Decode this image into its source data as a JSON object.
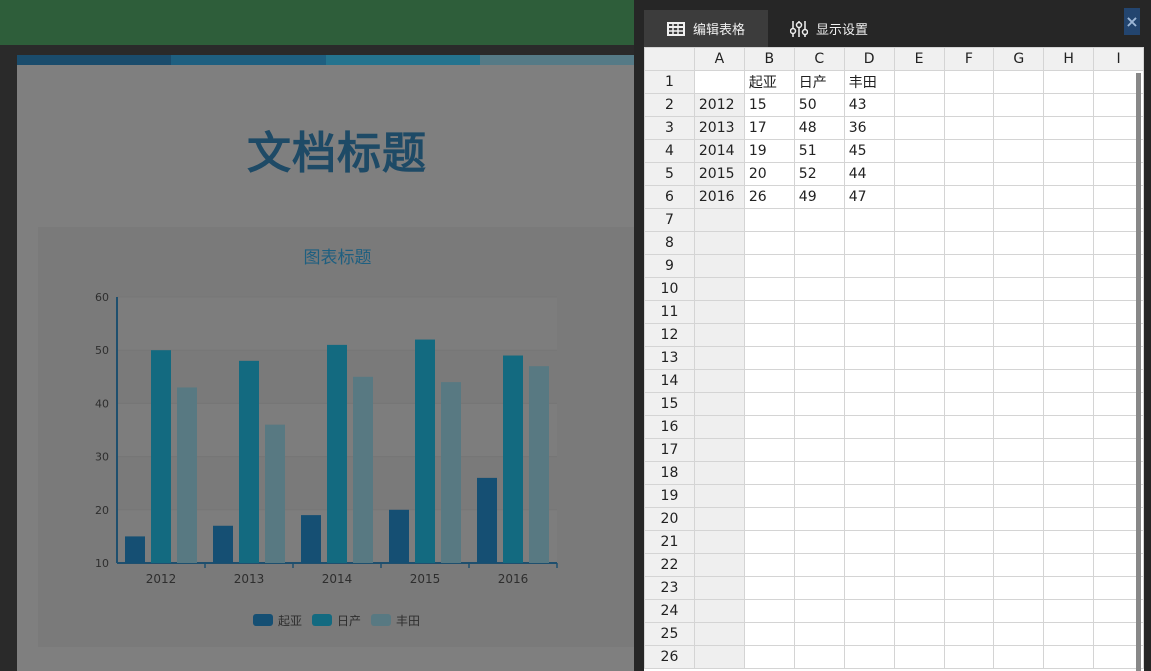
{
  "document": {
    "title": "文档标题",
    "title_color": "#1e4a66",
    "accent_colors": [
      "#1a4c6c",
      "#1e5f80",
      "#24738e",
      "#557a86"
    ]
  },
  "chart": {
    "title_color": "#1e5f80",
    "colors": [
      "#154f73",
      "#136a80",
      "#587982"
    ]
  },
  "chart_data": {
    "type": "bar",
    "title": "图表标题",
    "categories": [
      "2012",
      "2013",
      "2014",
      "2015",
      "2016"
    ],
    "series": [
      {
        "name": "起亚",
        "values": [
          15,
          17,
          19,
          20,
          26
        ]
      },
      {
        "name": "日产",
        "values": [
          50,
          48,
          51,
          52,
          49
        ]
      },
      {
        "name": "丰田",
        "values": [
          43,
          36,
          45,
          44,
          47
        ]
      }
    ],
    "ylim": [
      10,
      60
    ],
    "yticks": [
      10,
      20,
      30,
      40,
      50,
      60
    ],
    "grid": true,
    "legend": "bottom"
  },
  "panel": {
    "tabs": [
      {
        "label": "编辑表格",
        "icon": "table-icon",
        "active": true
      },
      {
        "label": "显示设置",
        "icon": "sliders-icon",
        "active": false
      }
    ],
    "close_label": "×"
  },
  "sheet": {
    "columns": [
      "A",
      "B",
      "C",
      "D",
      "E",
      "F",
      "G",
      "H",
      "I"
    ],
    "row_count": 26,
    "rows": [
      [
        "",
        "起亚",
        "日产",
        "丰田"
      ],
      [
        "2012",
        "15",
        "50",
        "43"
      ],
      [
        "2013",
        "17",
        "48",
        "36"
      ],
      [
        "2014",
        "19",
        "51",
        "45"
      ],
      [
        "2015",
        "20",
        "52",
        "44"
      ],
      [
        "2016",
        "26",
        "49",
        "47"
      ]
    ]
  }
}
